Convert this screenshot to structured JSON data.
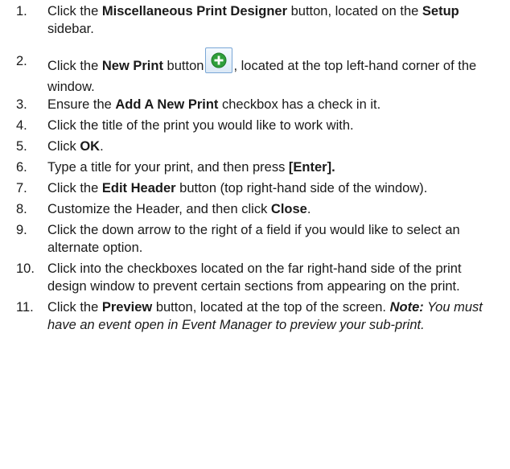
{
  "steps": [
    {
      "num": "1.",
      "parts": [
        "Click the ",
        "Miscellaneous Print Designer",
        " button, located on the ",
        "Setup",
        " sidebar."
      ]
    },
    {
      "num": "2.",
      "parts": [
        "Click the ",
        "New Print",
        " button",
        ", located at the top left-hand corner of the window."
      ]
    },
    {
      "num": "3.",
      "parts": [
        "Ensure the ",
        "Add A New Print",
        " checkbox has a check in it."
      ]
    },
    {
      "num": "4.",
      "parts": [
        "Click the title of the print you would like to work with."
      ]
    },
    {
      "num": "5.",
      "parts": [
        "Click ",
        "OK",
        "."
      ]
    },
    {
      "num": "6.",
      "parts": [
        "Type a title for your print, and then press ",
        "[Enter]."
      ]
    },
    {
      "num": "7.",
      "parts": [
        "Click the ",
        "Edit Header",
        " button (top right-hand side of the window)."
      ]
    },
    {
      "num": "8.",
      "parts": [
        "Customize the Header, and then click ",
        "Close",
        "."
      ]
    },
    {
      "num": "9.",
      "parts": [
        "Click the down arrow to the right of a field if you would like to select an alternate option."
      ]
    },
    {
      "num": "10.",
      "parts": [
        "Click into the checkboxes located on the far right-hand side of the print design window to prevent certain sections from appearing on the print."
      ]
    },
    {
      "num": "11.",
      "parts": [
        "Click the ",
        "Preview",
        " button, located at the top of the screen."
      ],
      "note_label": "Note:",
      "note_text": " You must have an event open in Event Manager to preview your sub-print."
    }
  ],
  "icons": {
    "new_print": "add-circle-icon",
    "new_print_color": "#2e9e3a"
  }
}
